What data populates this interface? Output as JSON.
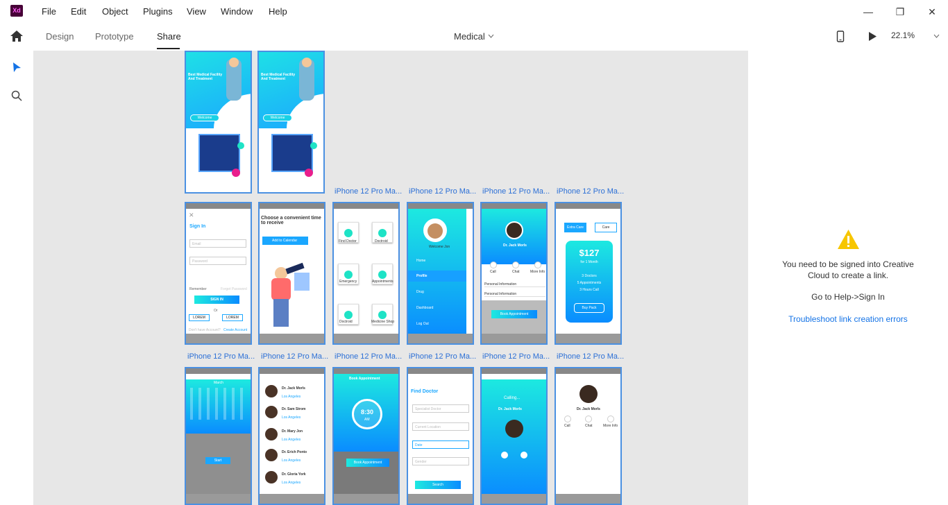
{
  "app": {
    "logo_text": "Xd"
  },
  "menu": [
    "File",
    "Edit",
    "Object",
    "Plugins",
    "View",
    "Window",
    "Help"
  ],
  "window_controls": {
    "minimize": "—",
    "maximize": "❐",
    "close": "✕"
  },
  "tabs": [
    {
      "label": "Design"
    },
    {
      "label": "Prototype"
    },
    {
      "label": "Share"
    }
  ],
  "document": {
    "title": "Medical"
  },
  "zoom": "22.1%",
  "artboard_label": "iPhone 12 Pro Ma...",
  "art": {
    "welcome_title": "Best Medical Facility And Treatment",
    "welcome_btn": "Welcome",
    "signin_title": "Sign In",
    "email": "Email",
    "password": "Password",
    "remember": "Remember",
    "forgot": "Forget Password",
    "signin_btn": "SIGN IN",
    "or": "Or",
    "lorem": "LOREM",
    "no_account": "Don't have Account?",
    "create": "Create Account",
    "choose": "Choose a convenient time to receive",
    "calendar": "Add to Calendar",
    "tiles": [
      "Find Doctor",
      "Doctroid",
      "Emergency",
      "Appointments",
      "Doctroid",
      "Medicine Shop"
    ],
    "drawer_items": [
      "Home",
      "Profile",
      "Drug",
      "Dashboard",
      "Log Out"
    ],
    "doctor_name": "Dr. Jack Morls",
    "location": "Los Angeles",
    "actions": [
      "Call",
      "Chat",
      "More Info"
    ],
    "personal": "Personal Information",
    "book": "Book Appointment",
    "plan_tabs": [
      "Extra Care",
      "Care"
    ],
    "price": "$127",
    "per": "for 1 Month",
    "features": [
      "3 Doctors",
      "5 Appointments",
      "3 Hours Call"
    ],
    "buy": "Buy Pack",
    "month": "March",
    "start": "Start",
    "doctors": [
      "Dr. Jack Morls",
      "Dr. Sam Strom",
      "Dr. Mary Jon",
      "Dr. Erich Ponto",
      "Dr. Gloria York"
    ],
    "time": "8:30",
    "ampm": "AM",
    "find_doctor": "Find Doctor",
    "fields": [
      "Specialist Doctor",
      "Current Location",
      "Date",
      "Gender"
    ],
    "search": "Search",
    "calling": "Calling...",
    "welcome_user": "Welcome Jon"
  },
  "panel": {
    "message": "You need to be signed into Creative Cloud to create a link.",
    "hint": "Go to Help->Sign In",
    "link": "Troubleshoot link creation errors"
  },
  "colors": {
    "accent": "#1473e6",
    "selection": "#4a90e2",
    "warning": "#f7c600",
    "gradient_from": "#1de9e0",
    "gradient_to": "#0a8cff"
  }
}
